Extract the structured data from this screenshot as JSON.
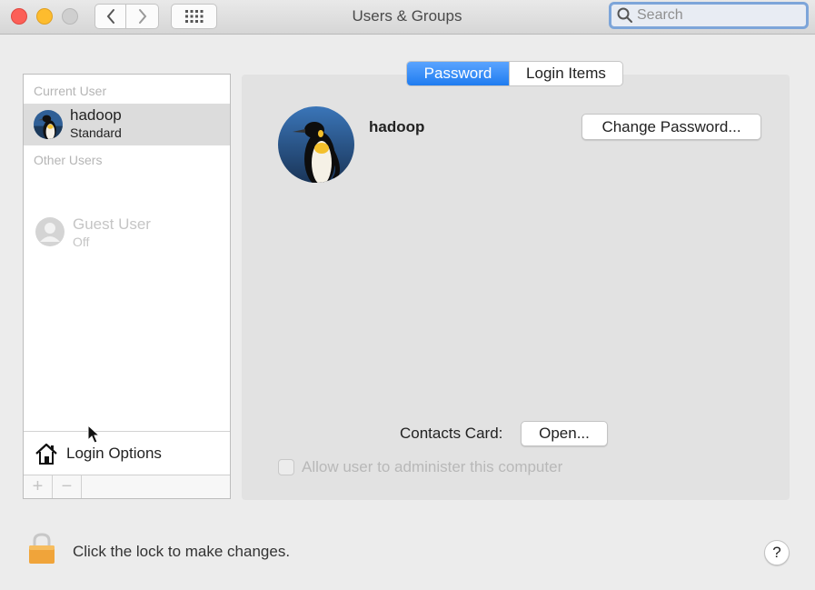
{
  "window": {
    "title": "Users & Groups"
  },
  "toolbar": {
    "search_placeholder": "Search"
  },
  "sidebar": {
    "current_user_label": "Current User",
    "current_user": {
      "name": "hadoop",
      "role": "Standard"
    },
    "other_users_label": "Other Users",
    "guest_user": {
      "name": "Guest User",
      "status": "Off"
    },
    "login_options_label": "Login Options",
    "add_symbol": "+",
    "remove_symbol": "−"
  },
  "tabs": [
    {
      "label": "Password",
      "selected": true
    },
    {
      "label": "Login Items",
      "selected": false
    }
  ],
  "detail": {
    "user_name": "hadoop",
    "change_password_label": "Change Password...",
    "contacts_card_label": "Contacts Card:",
    "open_label": "Open...",
    "allow_admin_label": "Allow user to administer this computer",
    "allow_admin_checked": false
  },
  "footer": {
    "lock_text": "Click the lock to make changes.",
    "help_label": "?"
  },
  "colors": {
    "accent": "#1f7cf0",
    "close": "#fc5f57",
    "minimize": "#fdbc2e"
  }
}
